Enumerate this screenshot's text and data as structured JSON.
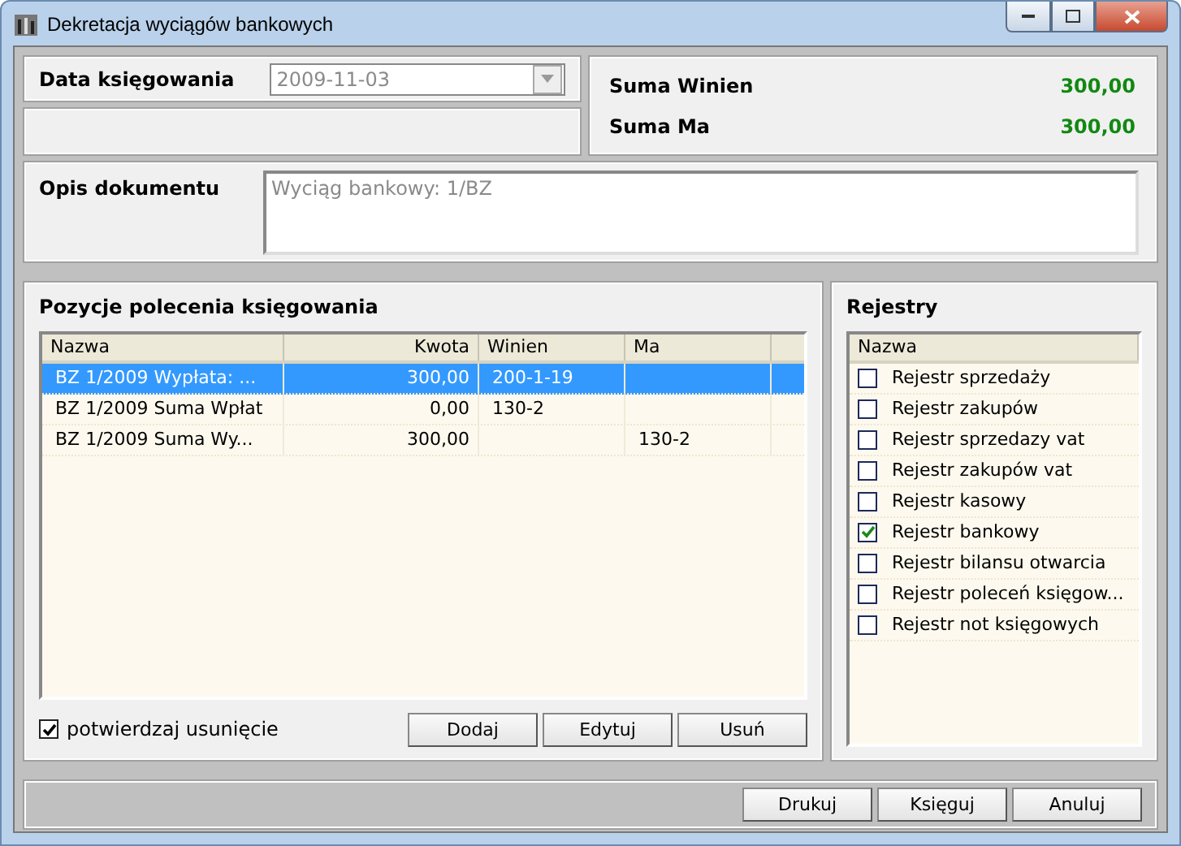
{
  "window": {
    "title": "Dekretacja wyciągów bankowych"
  },
  "date": {
    "label": "Data księgowania",
    "value": "2009-11-03",
    "disabled": true
  },
  "totals": [
    {
      "label": "Suma Winien",
      "value": "300,00"
    },
    {
      "label": "Suma Ma",
      "value": "300,00"
    }
  ],
  "description": {
    "label": "Opis dokumentu",
    "value": "Wyciąg bankowy: 1/BZ"
  },
  "positions": {
    "title": "Pozycje polecenia księgowania",
    "columns": [
      "Nazwa",
      "Kwota",
      "Winien",
      "Ma"
    ],
    "rows": [
      {
        "cells": [
          "BZ 1/2009 Wypłata: ...",
          "300,00",
          "200-1-19",
          ""
        ],
        "selected": true
      },
      {
        "cells": [
          "BZ 1/2009 Suma Wpłat",
          "0,00",
          "130-2",
          ""
        ],
        "selected": false
      },
      {
        "cells": [
          "BZ 1/2009 Suma Wy...",
          "300,00",
          "",
          "130-2"
        ],
        "selected": false
      }
    ],
    "confirm": {
      "label": "potwierdzaj usunięcie",
      "checked": true
    },
    "buttons": [
      "Dodaj",
      "Edytuj",
      "Usuń"
    ]
  },
  "registers": {
    "title": "Rejestry",
    "column": "Nazwa",
    "items": [
      {
        "label": "Rejestr sprzedaży",
        "checked": false
      },
      {
        "label": "Rejestr zakupów",
        "checked": false
      },
      {
        "label": "Rejestr sprzedazy vat",
        "checked": false
      },
      {
        "label": "Rejestr zakupów vat",
        "checked": false
      },
      {
        "label": "Rejestr kasowy",
        "checked": false
      },
      {
        "label": "Rejestr bankowy",
        "checked": true
      },
      {
        "label": "Rejestr bilansu otwarcia",
        "checked": false
      },
      {
        "label": "Rejestr poleceń księgow...",
        "checked": false
      },
      {
        "label": "Rejestr not księgowych",
        "checked": false
      }
    ]
  },
  "footer_buttons": [
    "Drukuj",
    "Księguj",
    "Anuluj"
  ]
}
